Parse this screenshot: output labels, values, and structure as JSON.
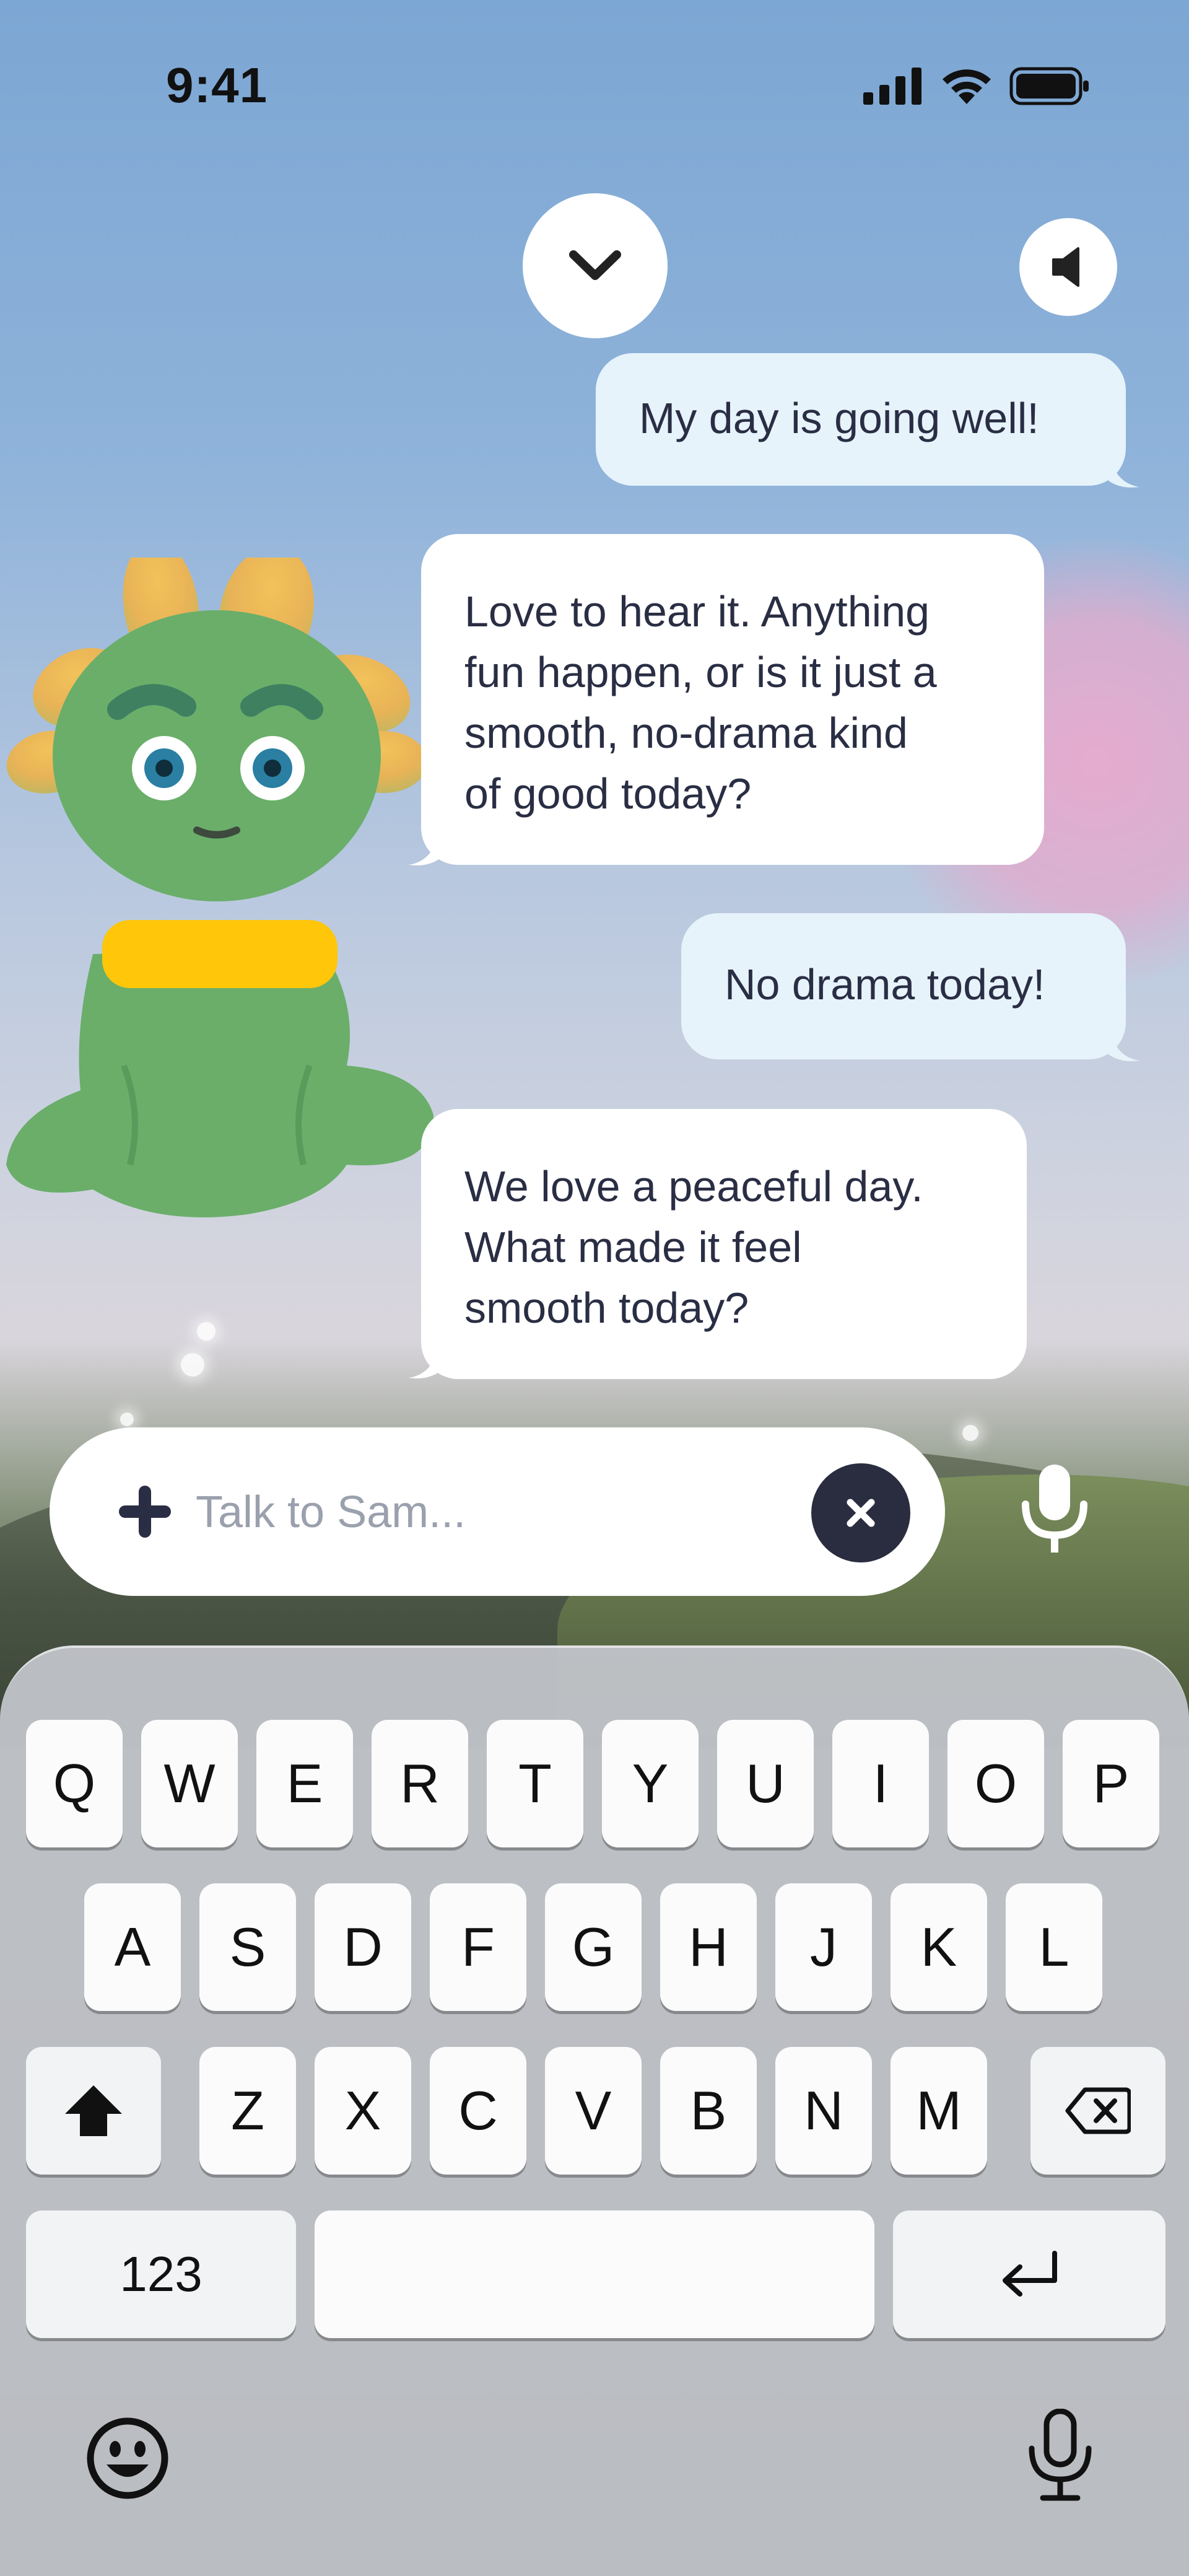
{
  "status_bar": {
    "time": "9:41"
  },
  "colors": {
    "user_bubble": "#e6f3fb",
    "bot_bubble": "#ffffff",
    "character_green": "#6aae6a",
    "collar_yellow": "#ffc60a",
    "mic_icon": "#ffffff"
  },
  "icons": {
    "collapse": "chevron-down-icon",
    "sound": "speaker-icon",
    "attach": "plus-icon",
    "clear": "close-icon",
    "voice": "microphone-icon",
    "emoji": "emoji-icon",
    "dictation": "microphone-icon",
    "delete": "delete-icon",
    "shift": "shift-icon",
    "return": "return-icon"
  },
  "messages": [
    {
      "role": "user",
      "lines": [
        "My day is going well!"
      ]
    },
    {
      "role": "bot",
      "lines": [
        "Love to hear it. Anything",
        "fun happen, or is it just a",
        "smooth, no-drama kind",
        "of good today?"
      ]
    },
    {
      "role": "user",
      "lines": [
        "No drama today!"
      ]
    },
    {
      "role": "bot",
      "lines": [
        "We love a peaceful day.",
        "What made it feel",
        "smooth today?"
      ]
    }
  ],
  "input": {
    "placeholder": "Talk to Sam..."
  },
  "keyboard": {
    "row1": [
      "Q",
      "W",
      "E",
      "R",
      "T",
      "Y",
      "U",
      "I",
      "O",
      "P"
    ],
    "row2": [
      "A",
      "S",
      "D",
      "F",
      "G",
      "H",
      "J",
      "K",
      "L"
    ],
    "row3": [
      "Z",
      "X",
      "C",
      "V",
      "B",
      "N",
      "M"
    ],
    "numbers_key": "123"
  }
}
